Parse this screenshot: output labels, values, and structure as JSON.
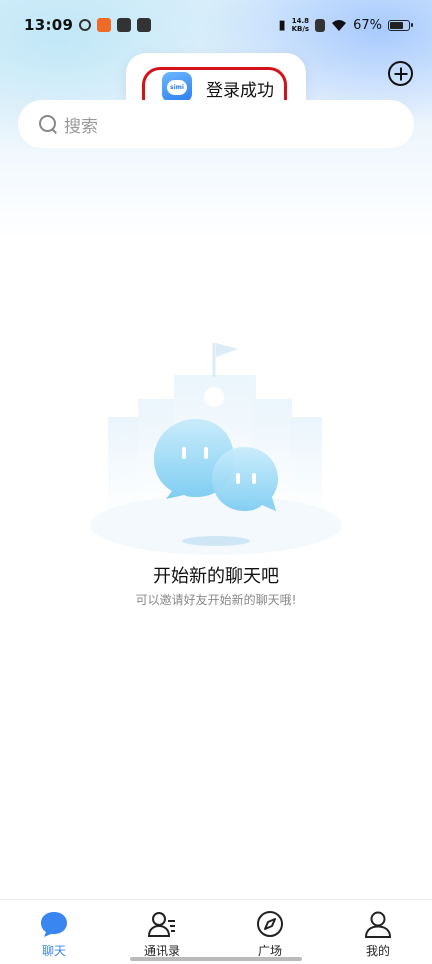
{
  "status_bar": {
    "time": "13:09",
    "net_speed_value": "14.8",
    "net_speed_unit": "KB/s",
    "battery_percent": "67%",
    "battery_level": 0.67
  },
  "toast": {
    "icon_label": "simi",
    "message": "登录成功"
  },
  "header": {
    "add_icon": "plus-circle-icon"
  },
  "search": {
    "placeholder": "搜索"
  },
  "empty_state": {
    "title": "开始新的聊天吧",
    "subtitle": "可以邀请好友开始新的聊天哦!"
  },
  "tabs": [
    {
      "label": "聊天",
      "icon": "chat-bubble-icon",
      "active": true
    },
    {
      "label": "通讯录",
      "icon": "contacts-icon",
      "active": false
    },
    {
      "label": "广场",
      "icon": "compass-icon",
      "active": false
    },
    {
      "label": "我的",
      "icon": "profile-icon",
      "active": false
    }
  ],
  "colors": {
    "accent": "#3a86f0",
    "highlight_border": "#d3121a"
  }
}
